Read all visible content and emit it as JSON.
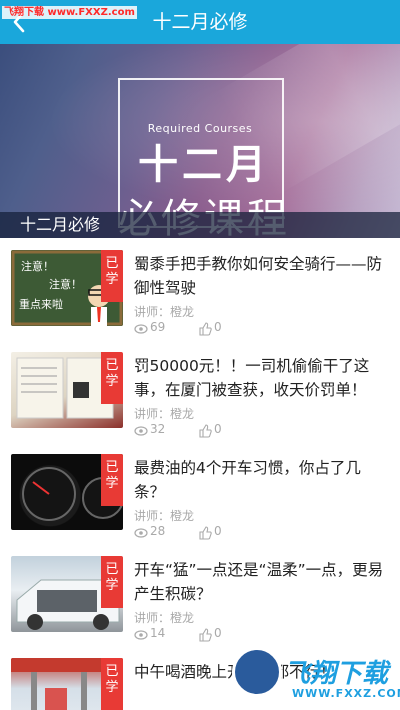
{
  "watermark": {
    "top_left": "飞翔下载 www.FXXZ.com",
    "bottom_right_brand": "飞翔下载",
    "bottom_right_url": "WWW.FXXZ.COM"
  },
  "header": {
    "title": "十二月必修",
    "back_icon": "chevron-left-icon"
  },
  "banner": {
    "subtitle": "Required Courses",
    "line1": "十二月",
    "line2": "必修课程"
  },
  "section": {
    "title": "十二月必修"
  },
  "colors": {
    "header_bg": "#1aa7db",
    "ribbon": "#e83a35",
    "meta_text": "#a9a9a9"
  },
  "courses": [
    {
      "badge": "已学",
      "title": "蜀黍手把手教你如何安全骑行——防御性驾驶",
      "teacher": "讲师：橙龙",
      "views": "69",
      "likes": "0",
      "thumb_text": [
        "注意！",
        "注意！",
        "重点来啦"
      ]
    },
    {
      "badge": "已学",
      "title": "罚50000元！！一司机偷偷干了这事，在厦门被查获，收天价罚单！",
      "teacher": "讲师：橙龙",
      "views": "32",
      "likes": "0"
    },
    {
      "badge": "已学",
      "title": "最费油的4个开车习惯，你占了几条？",
      "teacher": "讲师：橙龙",
      "views": "28",
      "likes": "0"
    },
    {
      "badge": "已学",
      "title": "开车“猛”一点还是“温柔”一点，更易产生积碳？",
      "teacher": "讲师：橙龙",
      "views": "14",
      "likes": "0"
    },
    {
      "badge": "已学",
      "title": "中午喝酒晚上开车，都不行！",
      "teacher": "",
      "views": "",
      "likes": ""
    }
  ]
}
